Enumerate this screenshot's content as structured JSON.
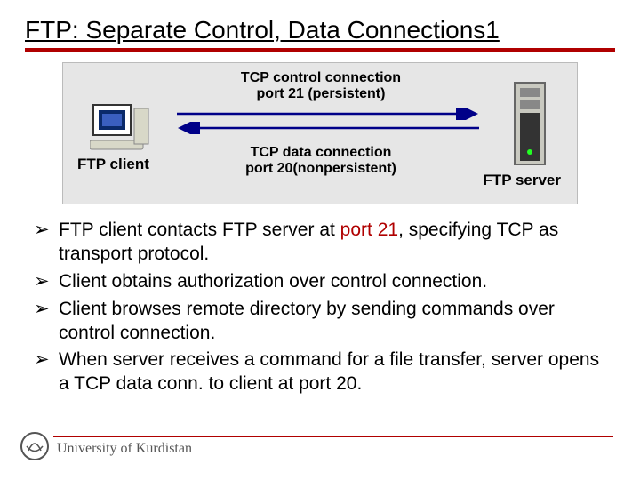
{
  "title": "FTP: Separate Control, Data Connections1",
  "diagram": {
    "client_label": "FTP client",
    "server_label": "FTP server",
    "control_line1": "TCP control connection",
    "control_line2": "port 21 (persistent)",
    "data_line1": "TCP data connection",
    "data_line2": "port 20(nonpersistent)",
    "arrow_color": "#000088"
  },
  "bullets": [
    {
      "pre": "FTP client contacts FTP server at ",
      "port": "port 21",
      "port_class": "p21",
      "post": ", specifying TCP as transport protocol."
    },
    {
      "pre": "Client obtains authorization over control connection.",
      "port": "",
      "port_class": "",
      "post": ""
    },
    {
      "pre": "Client browses remote directory by sending commands over control connection.",
      "port": "",
      "port_class": "",
      "post": ""
    },
    {
      "pre": "When server receives a command for a file transfer, server opens a TCP data conn. to client at ",
      "port": "port 20",
      "port_class": "p20",
      "post": "."
    }
  ],
  "footer": {
    "university": "University of Kurdistan"
  }
}
